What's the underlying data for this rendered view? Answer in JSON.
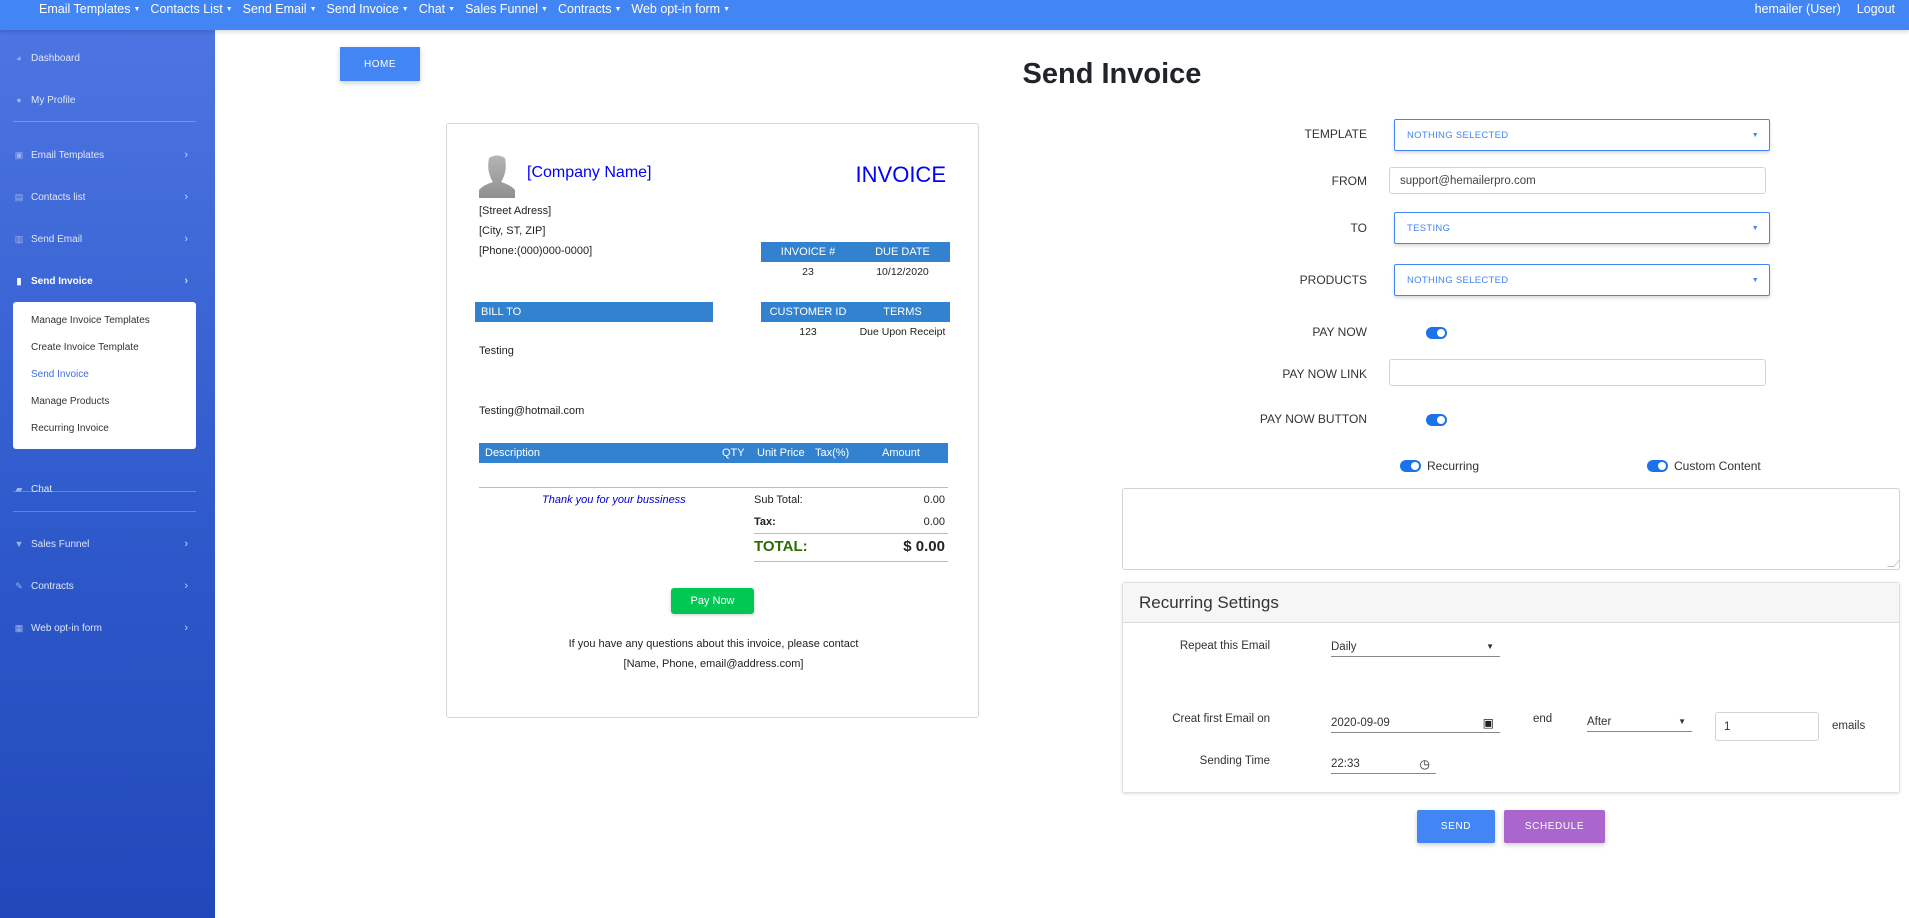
{
  "topnav": {
    "menu": [
      {
        "label": "Email Templates"
      },
      {
        "label": "Contacts List"
      },
      {
        "label": "Send Email"
      },
      {
        "label": "Send Invoice"
      },
      {
        "label": "Chat"
      },
      {
        "label": "Sales Funnel"
      },
      {
        "label": "Contracts"
      },
      {
        "label": "Web opt-in form"
      }
    ],
    "caret": "▼",
    "user": "hemailer (User)",
    "logout": "Logout"
  },
  "sidebar": {
    "items": [
      {
        "label": "Dashboard",
        "icon": "◕"
      },
      {
        "label": "My Profile",
        "icon": "●"
      },
      {
        "label": "Email Templates",
        "icon": "▣"
      },
      {
        "label": "Contacts list",
        "icon": "▤"
      },
      {
        "label": "Send Email",
        "icon": "▥"
      },
      {
        "label": "Send Invoice",
        "icon": "▮"
      },
      {
        "label": "Chat",
        "icon": "▰"
      },
      {
        "label": "Sales Funnel",
        "icon": "▼"
      },
      {
        "label": "Contracts",
        "icon": "✎"
      },
      {
        "label": "Web opt-in form",
        "icon": "▦"
      }
    ],
    "chevron": "›",
    "submenu": [
      {
        "label": "Manage Invoice Templates"
      },
      {
        "label": "Create Invoice Template"
      },
      {
        "label": "Send Invoice"
      },
      {
        "label": "Manage Products"
      },
      {
        "label": "Recurring Invoice"
      }
    ]
  },
  "home_button": "HOME",
  "page_title": "Send Invoice",
  "invoice": {
    "company_name": "[Company Name]",
    "title": "INVOICE",
    "address": [
      "[Street Adress]",
      "[City, ST, ZIP]",
      "[Phone:(000)000-0000]"
    ],
    "invoice_no_header": "INVOICE #",
    "due_date_header": "DUE DATE",
    "invoice_no": "23",
    "due_date": "10/12/2020",
    "bill_to_header": "BILL TO",
    "customer_id_header": "CUSTOMER ID",
    "terms_header": "TERMS",
    "customer_id": "123",
    "terms": "Due Upon Receipt",
    "bill_name": "Testing",
    "bill_email": "Testing@hotmail.com",
    "columns": [
      "Description",
      "QTY",
      "Unit Price",
      "Tax(%)",
      "Amount"
    ],
    "thanks": "Thank you for your bussiness",
    "subtotal_label": "Sub Total:",
    "subtotal": "0.00",
    "tax_label": "Tax:",
    "tax": "0.00",
    "total_label": "TOTAL:",
    "total": "$ 0.00",
    "pay_now": "Pay Now",
    "footer1": "If you have any questions about this invoice, please contact",
    "footer2": "[Name, Phone, email@address.com]",
    "colors": {
      "header_bar": "#3282cf",
      "company": "#0000ff",
      "total": "#2e6b00",
      "pay_button": "#00c853"
    }
  },
  "form": {
    "template_label": "TEMPLATE",
    "template_value": "NOTHING SELECTED",
    "from_label": "FROM",
    "from_value": "support@hemailerpro.com",
    "to_label": "TO",
    "to_value": "TESTING",
    "products_label": "PRODUCTS",
    "products_value": "NOTHING SELECTED",
    "pay_now_label": "PAY NOW",
    "pay_now_on": true,
    "pay_now_link_label": "PAY NOW LINK",
    "pay_now_link_value": "",
    "pay_now_button_label": "PAY NOW BUTTON",
    "pay_now_button_on": true,
    "recurring_label": "Recurring",
    "recurring_on": true,
    "custom_content_label": "Custom Content",
    "custom_content_on": true,
    "custom_content_value": ""
  },
  "recurring": {
    "title": "Recurring Settings",
    "repeat_label": "Repeat this Email",
    "repeat_value": "Daily",
    "first_label": "Creat first Email on",
    "first_value": "2020-09-09",
    "end_label": "end",
    "end_value": "After",
    "count_value": "1",
    "count_suffix": "emails",
    "time_label": "Sending Time",
    "time_value": "22:33"
  },
  "actions": {
    "send": "SEND",
    "schedule": "SCHEDULE",
    "send_color": "#4285f4",
    "schedule_color": "#aa66cc"
  }
}
